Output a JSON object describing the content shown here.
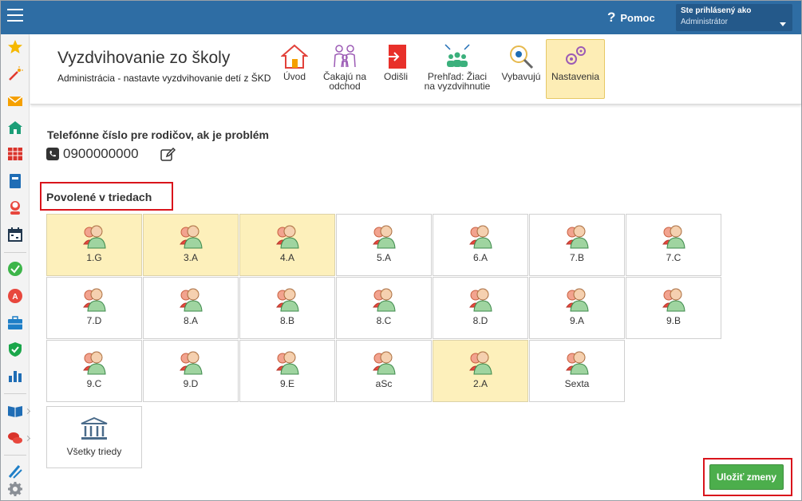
{
  "topbar": {
    "help_icon": "question-mark",
    "help_label": "Pomoc",
    "user_line1": "Ste prihlásený ako",
    "user_line2": "Administrátor"
  },
  "sidebar": {
    "icons": [
      "star-icon",
      "magic-wand-icon",
      "mail-icon",
      "school-icon",
      "timetable-icon",
      "notebook-icon",
      "student-icon",
      "calendar-icon",
      "check-circle-icon",
      "grade-icon",
      "briefcase-icon",
      "shield-check-icon",
      "chart-icon",
      "book-icon",
      "chat-icon",
      "pen-icon",
      "settings-icon"
    ]
  },
  "header": {
    "title": "Vyzdvihovanie zo školy",
    "subtitle": "Administrácia - nastavte vyzdvihovanie detí z ŠKD",
    "nav": [
      {
        "label1": "Úvod",
        "label2": "",
        "icon": "house-icon"
      },
      {
        "label1": "Čakajú na",
        "label2": "odchod",
        "icon": "family-icon"
      },
      {
        "label1": "Odišli",
        "label2": "",
        "icon": "exit-icon"
      },
      {
        "label1": "Prehľad: Žiaci",
        "label2": "na vyzdvihnutie",
        "icon": "group-icon"
      },
      {
        "label1": "Vybavujú",
        "label2": "",
        "icon": "magnifier-icon"
      },
      {
        "label1": "Nastavenia",
        "label2": "",
        "icon": "gears-icon"
      }
    ],
    "active": "Nastavenia"
  },
  "phone": {
    "title": "Telefónne číslo pre rodičov, ak je problém",
    "number": "0900000000"
  },
  "classes": {
    "title": "Povolené v triedach",
    "items": [
      {
        "name": "1.G",
        "enabled": true
      },
      {
        "name": "3.A",
        "enabled": true
      },
      {
        "name": "4.A",
        "enabled": true
      },
      {
        "name": "5.A",
        "enabled": false
      },
      {
        "name": "6.A",
        "enabled": false
      },
      {
        "name": "7.B",
        "enabled": false
      },
      {
        "name": "7.C",
        "enabled": false
      },
      {
        "name": "7.D",
        "enabled": false
      },
      {
        "name": "8.A",
        "enabled": false
      },
      {
        "name": "8.B",
        "enabled": false
      },
      {
        "name": "8.C",
        "enabled": false
      },
      {
        "name": "8.D",
        "enabled": false
      },
      {
        "name": "9.A",
        "enabled": false
      },
      {
        "name": "9.B",
        "enabled": false
      },
      {
        "name": "9.C",
        "enabled": false
      },
      {
        "name": "9.D",
        "enabled": false
      },
      {
        "name": "9.E",
        "enabled": false
      },
      {
        "name": "aSc",
        "enabled": false
      },
      {
        "name": "2.A",
        "enabled": true
      },
      {
        "name": "Sexta",
        "enabled": false
      }
    ],
    "all_label": "Všetky triedy"
  },
  "save_label": "Uložiť zmeny",
  "colors": {
    "topbar": "#2e6da4",
    "active_bg": "#fdf0bb",
    "save": "#4cae4c",
    "highlight": "#d9141c"
  }
}
